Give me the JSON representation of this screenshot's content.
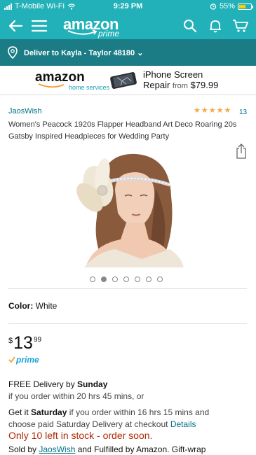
{
  "status_bar": {
    "carrier": "T-Mobile Wi-Fi",
    "time": "9:29 PM",
    "battery": "55%",
    "battery_level": 0.55
  },
  "header": {
    "logo_text": "amazon",
    "logo_sub": "prime",
    "icons": [
      "back-arrow-icon",
      "menu-icon",
      "search-icon",
      "bell-icon",
      "cart-icon"
    ]
  },
  "delivery": {
    "text": "Deliver to Kayla - Taylor 48180 ⌄"
  },
  "ad": {
    "brand": "amazon",
    "brand_sub": "home services",
    "line1": "iPhone Screen",
    "line2": "Repair",
    "from": "from",
    "price": "$79.99"
  },
  "product": {
    "brand": "JaosWish",
    "rating_count": "13",
    "stars": 5,
    "title": "Women's Peacock 1920s Flapper Headband Art Deco Roaring 20s Gatsby Inspired Headpieces for Wedding Party",
    "image_count": 7,
    "active_image": 2,
    "color_label": "Color:",
    "color_value": "White",
    "price_currency": "$",
    "price_whole": "13",
    "price_fraction": "99",
    "prime_label": "prime"
  },
  "shipping": {
    "free_delivery": "FREE Delivery by",
    "free_day": "Sunday",
    "order_within": "if you order within 20 hrs 45 mins, or",
    "get_it": "Get it",
    "get_day": "Saturday",
    "order_within2": "if you order within 16 hrs 15 mins and",
    "choose_paid": "choose paid Saturday Delivery at checkout",
    "details": "Details",
    "stock": "Only 10 left in stock - order soon.",
    "sold_by": "Sold by",
    "seller": "JaosWish",
    "fulfilled": "and Fulfilled by Amazon. Gift-wrap"
  }
}
